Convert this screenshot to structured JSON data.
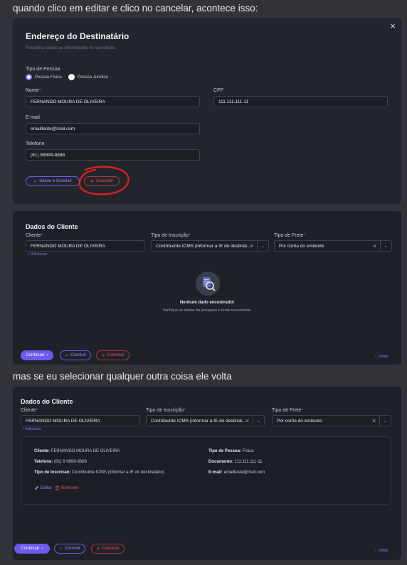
{
  "messages": {
    "first": "quando clico em editar e clico no cancelar, acontece isso:",
    "second": "mas se eu selecionar qualquer outra coisa ele volta"
  },
  "modal": {
    "title": "Endereço do Destinatário",
    "subtitle": "Preencha abaixo as informações do seu cliente.",
    "close_icon": "×",
    "tipo_pessoa_label": "Tipo de Pessoa",
    "options": [
      "Pessoa Física",
      "Pessoa Jurídica"
    ],
    "nome_label": "Nome",
    "nome_value": "FERNANDO MOURA DE OLIVEIRA",
    "cpf_label": "CPF",
    "cpf_value": "111.111.111-11",
    "email_label": "E-mail",
    "email_value": "emailteste@mail.com",
    "telefone_label": "Telefone",
    "telefone_value": "(61) 99999-8888",
    "save_label": "Salvar e Concluir",
    "cancel_label": "Cancelar",
    "check_glyph": "✓",
    "x_glyph": "✕"
  },
  "panel_empty": {
    "title": "Dados do Cliente",
    "cliente_label": "Cliente",
    "cliente_value": "FERNANDO MOURA DE OLIVEIRA",
    "add_label": "+ Adicionar",
    "inscricao_label": "Tipo de Inscrição",
    "inscricao_value": "Contribuinte ICMS (informar a IE do destinat...",
    "frete_label": "Tipo de Frete",
    "frete_value": "Por conta do emitente",
    "empty_title": "Nenhum dado encontrado!",
    "empty_text": "Verifique os dados da pesquisa e tente novamente.",
    "continue_label": "Continuar",
    "conclude_label": "Concluir",
    "cancel_label": "Cancelar",
    "back_label": "Voltar",
    "arrow_glyph": "›",
    "back_glyph": "‹"
  },
  "panel_filled": {
    "title": "Dados do Cliente",
    "cliente_label": "Cliente",
    "cliente_value": "FERNANDO MOURA DE OLIVEIRA",
    "add_label": "+ Adicionar",
    "inscricao_label": "Tipo de Inscrição",
    "inscricao_value": "Contribuinte ICMS (informar a IE do destinat...",
    "frete_label": "Tipo de Frete",
    "frete_value": "Por conta do emitente",
    "card": {
      "cliente_k": "Cliente:",
      "cliente_v": "FERNANDO MOURA DE OLIVEIRA",
      "telefone_k": "Telefone:",
      "telefone_v": "(61) 9 9999-8888",
      "inscricao_k": "Tipo de Inscricao:",
      "inscricao_v": "Contribuinte ICMS (informar a IE do destinatário)",
      "pessoa_k": "Tipo de Pessoa:",
      "pessoa_v": "Física",
      "documento_k": "Documento:",
      "documento_v": "111.111.111-11",
      "email_k": "E-mail:",
      "email_v": "emailteste@mail.com",
      "edit_label": "Editar",
      "remove_label": "Remover"
    },
    "continue_label": "Continuar",
    "conclude_label": "Concluir",
    "cancel_label": "Cancelar",
    "back_label": "Voltar",
    "arrow_glyph": "›",
    "back_glyph": "‹"
  },
  "common": {
    "req_mark": "*",
    "clear_glyph": "✕",
    "chevron_glyph": "⌄"
  },
  "colors": {
    "accent": "#6a5cf0",
    "danger": "#e05a5f",
    "annotation": "#e0221f"
  }
}
